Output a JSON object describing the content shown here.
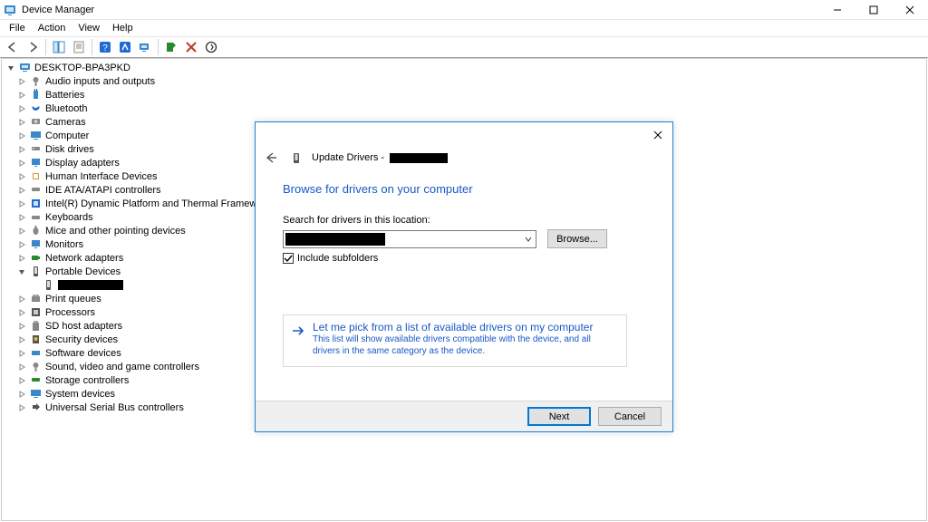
{
  "window": {
    "title": "Device Manager"
  },
  "menu": [
    "File",
    "Action",
    "View",
    "Help"
  ],
  "tree": {
    "root": "DESKTOP-BPA3PKD",
    "portable_child_redacted": true,
    "items": [
      "Audio inputs and outputs",
      "Batteries",
      "Bluetooth",
      "Cameras",
      "Computer",
      "Disk drives",
      "Display adapters",
      "Human Interface Devices",
      "IDE ATA/ATAPI controllers",
      "Intel(R) Dynamic Platform and Thermal Framework",
      "Keyboards",
      "Mice and other pointing devices",
      "Monitors",
      "Network adapters",
      "Portable Devices",
      "Print queues",
      "Processors",
      "SD host adapters",
      "Security devices",
      "Software devices",
      "Sound, video and game controllers",
      "Storage controllers",
      "System devices",
      "Universal Serial Bus controllers"
    ]
  },
  "dialog": {
    "title_prefix": "Update Drivers - ",
    "heading": "Browse for drivers on your computer",
    "search_label": "Search for drivers in this location:",
    "browse_btn": "Browse...",
    "include_subfolders": "Include subfolders",
    "pick_title": "Let me pick from a list of available drivers on my computer",
    "pick_desc": "This list will show available drivers compatible with the device, and all drivers in the same category as the device.",
    "next": "Next",
    "cancel": "Cancel"
  }
}
